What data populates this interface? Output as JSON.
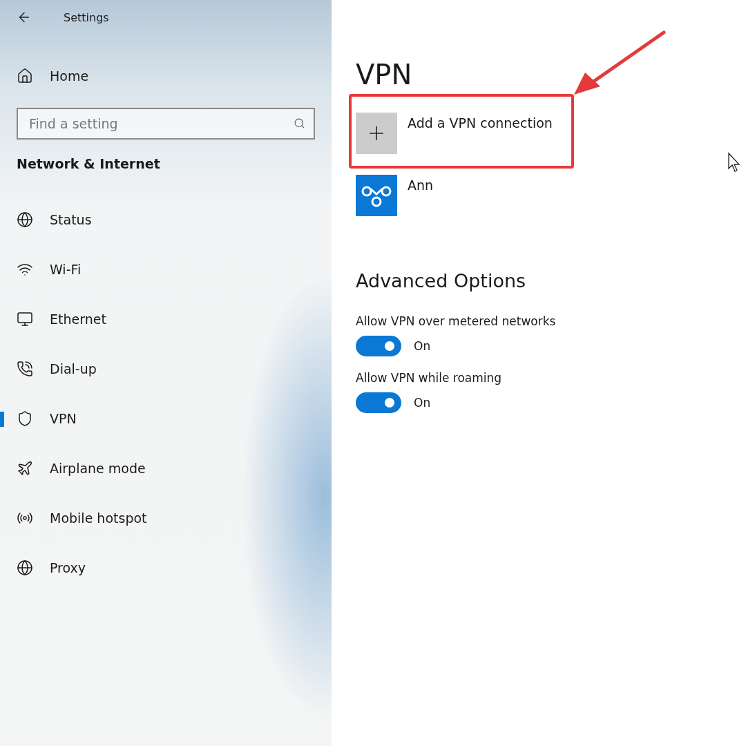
{
  "window": {
    "title": "Settings"
  },
  "sidebar": {
    "home": "Home",
    "search": {
      "placeholder": "Find a setting"
    },
    "section": "Network & Internet",
    "items": [
      {
        "label": "Status",
        "selected": false
      },
      {
        "label": "Wi-Fi",
        "selected": false
      },
      {
        "label": "Ethernet",
        "selected": false
      },
      {
        "label": "Dial-up",
        "selected": false
      },
      {
        "label": "VPN",
        "selected": true
      },
      {
        "label": "Airplane mode",
        "selected": false
      },
      {
        "label": "Mobile hotspot",
        "selected": false
      },
      {
        "label": "Proxy",
        "selected": false
      }
    ]
  },
  "main": {
    "title": "VPN",
    "connections": [
      {
        "kind": "add",
        "label": "Add a VPN connection",
        "highlighted": true
      },
      {
        "kind": "vpn",
        "label": "Ann",
        "highlighted": false
      }
    ],
    "advanced_title": "Advanced Options",
    "toggles": [
      {
        "label": "Allow VPN over metered networks",
        "on": true,
        "state_text": "On"
      },
      {
        "label": "Allow VPN while roaming",
        "on": true,
        "state_text": "On"
      }
    ]
  }
}
